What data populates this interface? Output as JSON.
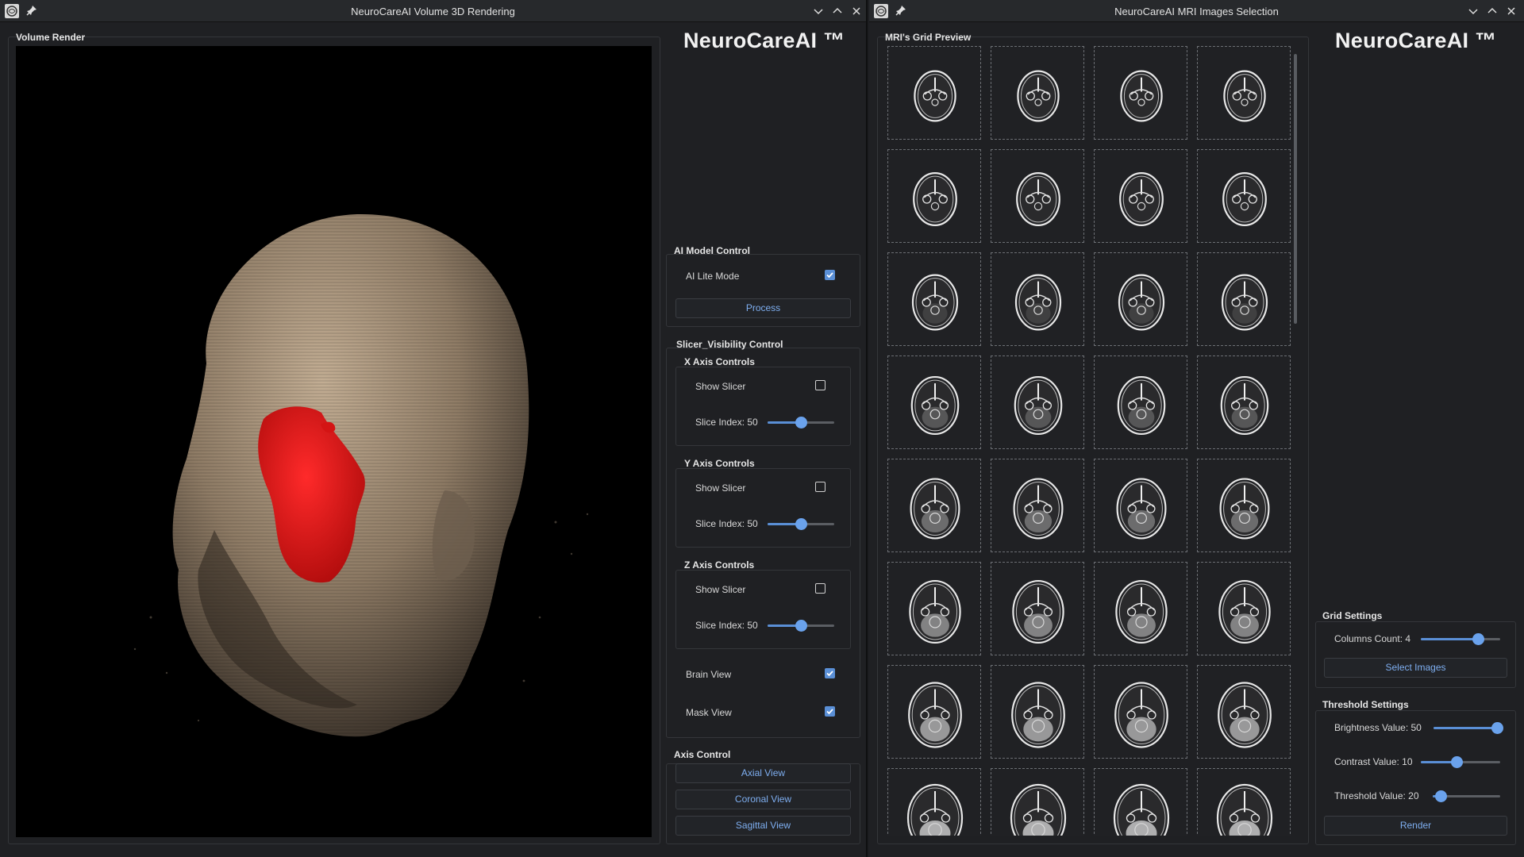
{
  "left_window": {
    "title": "NeuroCareAI Volume 3D Rendering",
    "brand": "NeuroCareAI ™",
    "render_panel_title": "Volume Render",
    "ai_model_control": {
      "title": "AI Model Control",
      "lite_mode_label": "AI Lite Mode",
      "lite_mode_checked": true,
      "process_label": "Process"
    },
    "slicer_visibility": {
      "title": "Slicer_Visibility Control",
      "x_axis": {
        "title": "X Axis Controls",
        "show_label": "Show Slicer",
        "show_checked": false,
        "slice_label": "Slice Index: 50",
        "slice_value": 50
      },
      "y_axis": {
        "title": "Y Axis Controls",
        "show_label": "Show Slicer",
        "show_checked": false,
        "slice_label": "Slice Index: 50",
        "slice_value": 50
      },
      "z_axis": {
        "title": "Z Axis Controls",
        "show_label": "Show Slicer",
        "show_checked": false,
        "slice_label": "Slice Index: 50",
        "slice_value": 50
      },
      "brain_view_label": "Brain View",
      "brain_view_checked": true,
      "mask_view_label": "Mask View",
      "mask_view_checked": true
    },
    "axis_control": {
      "title": "Axis Control",
      "axial_label": "Axial View",
      "coronal_label": "Coronal View",
      "sagittal_label": "Sagittal View"
    }
  },
  "right_window": {
    "title": "NeuroCareAI MRI Images Selection",
    "brand": "NeuroCareAI ™",
    "grid_preview_title": "MRI's Grid Preview",
    "grid_columns": 4,
    "grid_visible_rows": 8,
    "grid_settings": {
      "title": "Grid Settings",
      "columns_label": "Columns Count: 4",
      "columns_fraction": 0.72,
      "select_images_label": "Select Images"
    },
    "threshold_settings": {
      "title": "Threshold Settings",
      "brightness_label": "Brightness Value: 50",
      "brightness_fraction": 0.95,
      "contrast_label": "Contrast Value: 10",
      "contrast_fraction": 0.45,
      "threshold_label": "Threshold Value: 20",
      "threshold_fraction": 0.12,
      "render_label": "Render"
    }
  },
  "colors": {
    "accent": "#5a8fd6",
    "button_text": "#7eaef0",
    "tumor_mask": "#d41414",
    "head_volume": "#9a8670"
  }
}
